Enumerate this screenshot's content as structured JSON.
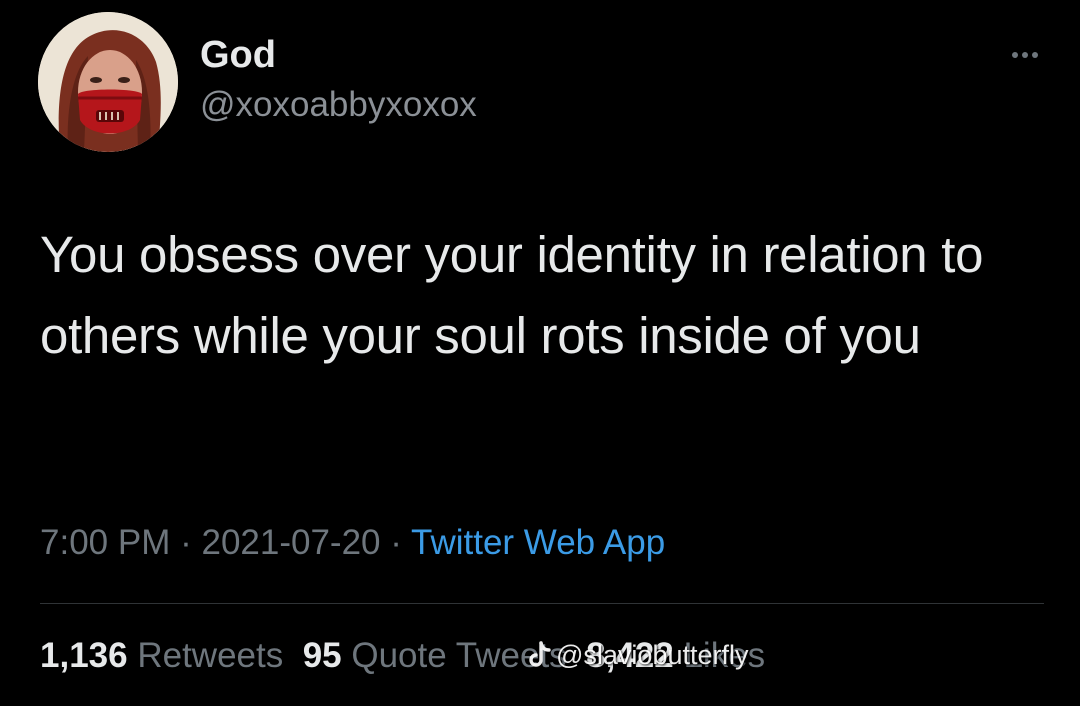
{
  "user": {
    "display_name": "God",
    "handle": "@xoxoabbyxoxox",
    "avatar_icon": "profile-photo"
  },
  "tweet": {
    "text": "You obsess over your identity in relation to others while your soul rots inside of you",
    "time": "7:00 PM",
    "separator": "·",
    "date": "2021-07-20",
    "source": "Twitter Web App"
  },
  "stats": {
    "retweets_count": "1,136",
    "retweets_label": "Retweets",
    "quotes_count": "95",
    "quotes_label": "Quote Tweets",
    "likes_count": "8,422",
    "likes_label": "Likes"
  },
  "watermark": {
    "text": "@slaviobutterfly",
    "icon": "tiktok-icon"
  },
  "colors": {
    "background": "#000000",
    "primary_text": "#e7e9ea",
    "secondary_text": "#6e767d",
    "link": "#3b9be6"
  }
}
